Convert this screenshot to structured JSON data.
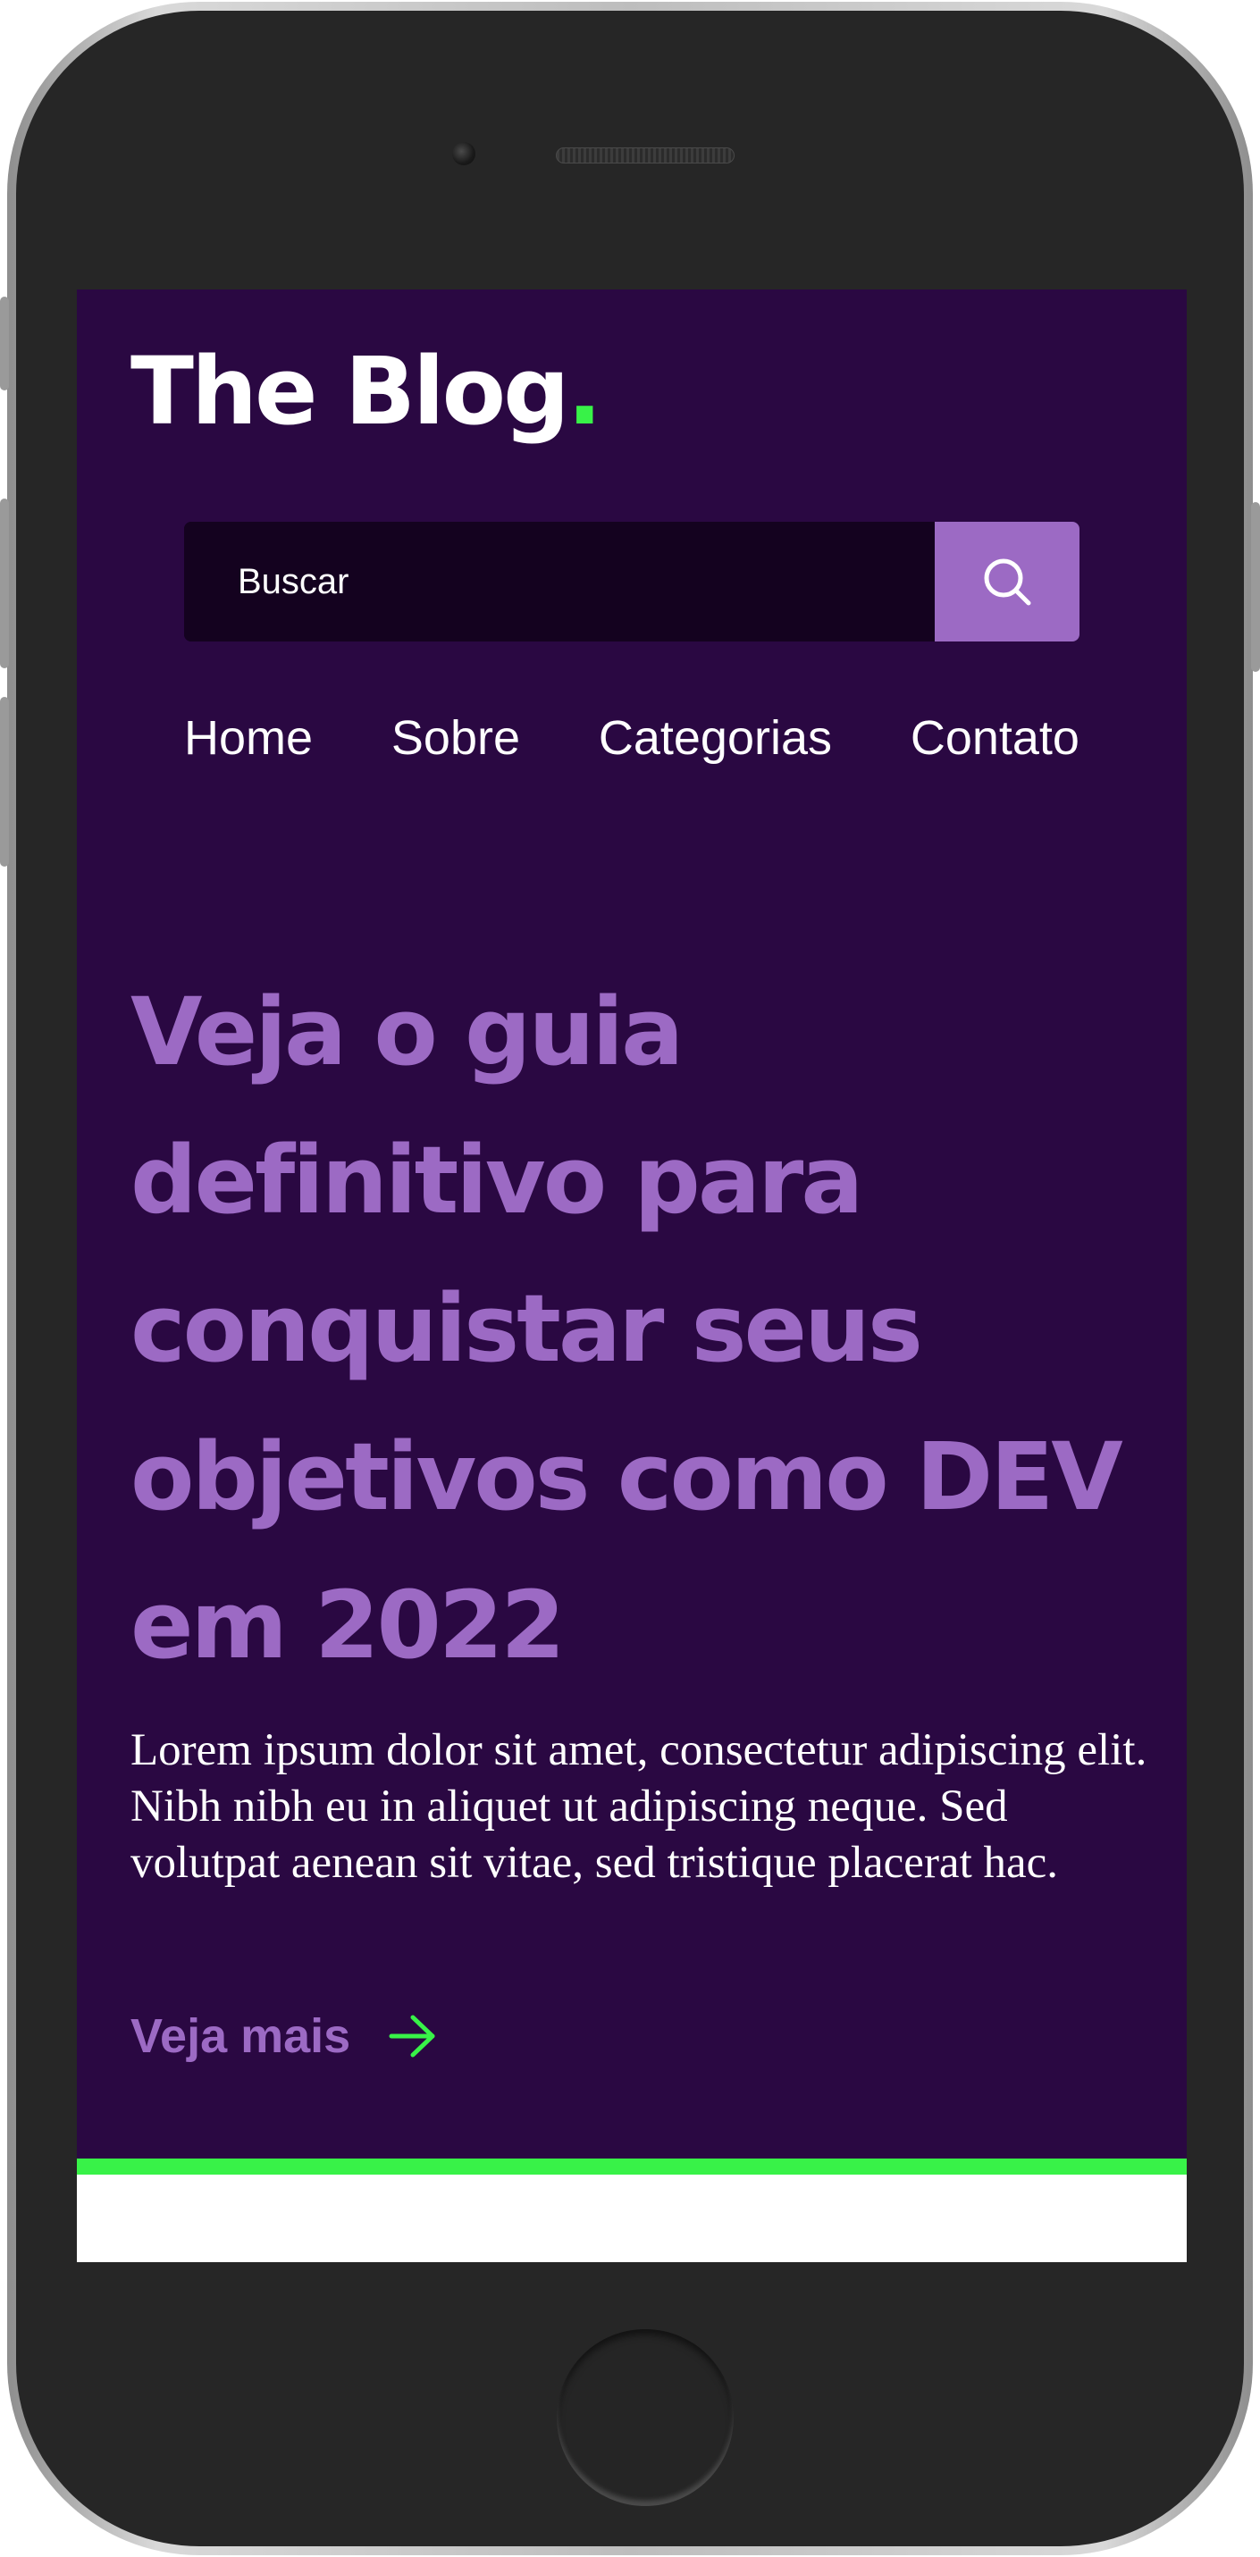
{
  "header": {
    "logo_text": "The Blog",
    "logo_dot": "."
  },
  "search": {
    "placeholder": "Buscar",
    "button_icon": "search-icon"
  },
  "nav": {
    "items": [
      {
        "label": "Home"
      },
      {
        "label": "Sobre"
      },
      {
        "label": "Categorias"
      },
      {
        "label": "Contato"
      }
    ]
  },
  "hero": {
    "title": "Veja o guia definitivo para conquistar seus objetivos como DEV em 2022",
    "text": "Lorem ipsum dolor sit amet, consectetur adipiscing elit. Nibh nibh eu in aliquet ut adipiscing neque. Sed volutpat aenean sit vitae, sed tristique placerat hac.",
    "link_label": "Veja mais",
    "link_icon": "arrow-right-icon"
  },
  "colors": {
    "background": "#2a0842",
    "accent": "#9c6ac4",
    "highlight": "#38f248",
    "search_field": "#14021f",
    "text": "#ffffff"
  }
}
